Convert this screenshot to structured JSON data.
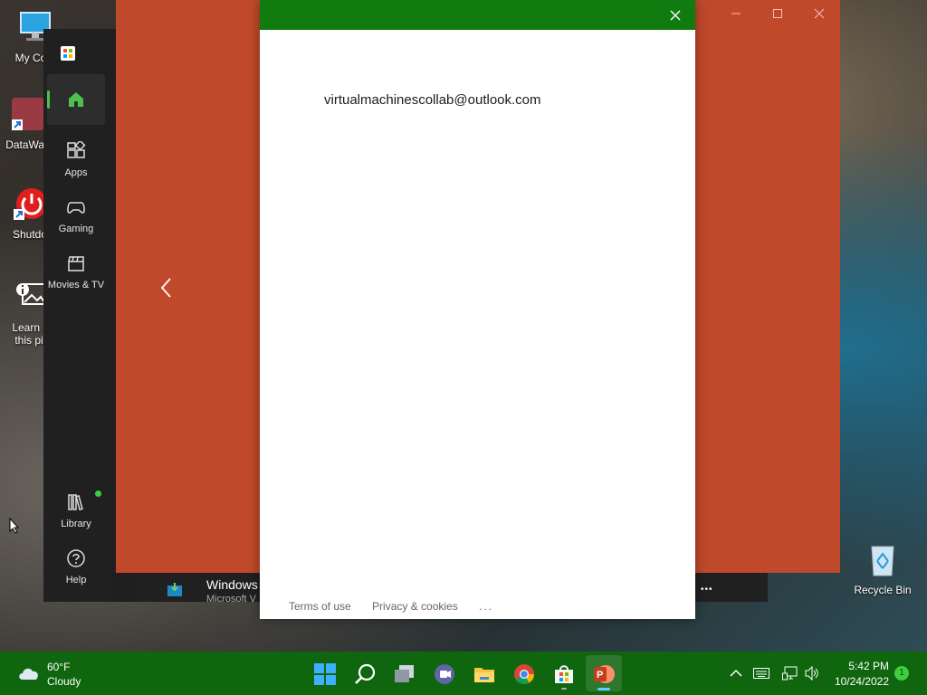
{
  "desktop": {
    "icons": [
      {
        "label": "My Com"
      },
      {
        "label": "DataWag"
      },
      {
        "label": "Shutdo"
      },
      {
        "label_line1": "Learn al",
        "label_line2": "this pic"
      },
      {
        "label": "Recycle Bin"
      }
    ]
  },
  "store": {
    "nav": [
      {
        "label": "Apps"
      },
      {
        "label": "Gaming"
      },
      {
        "label": "Movies & TV"
      },
      {
        "label": "Library"
      },
      {
        "label": "Help"
      }
    ],
    "bottom_item": {
      "title": "Windows",
      "subtitle": "Microsoft V"
    },
    "more_glyph": "•••"
  },
  "dialog": {
    "email": "virtualmachinescollab@outlook.com",
    "footer": {
      "terms": "Terms of use",
      "privacy": "Privacy & cookies",
      "more": "..."
    }
  },
  "taskbar": {
    "weather": {
      "temp": "60°F",
      "condition": "Cloudy"
    },
    "clock": {
      "time": "5:42 PM",
      "date": "10/24/2022"
    },
    "notification_count": "1"
  },
  "colors": {
    "accent_green": "#107c10",
    "orange_bg": "#c1492b",
    "store_dark": "#202020"
  }
}
